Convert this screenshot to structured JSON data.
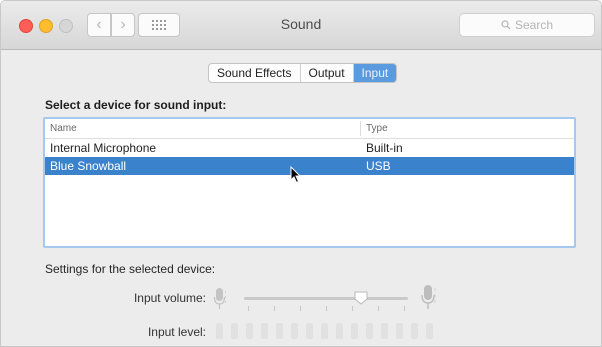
{
  "window": {
    "title": "Sound"
  },
  "search": {
    "placeholder": "Search"
  },
  "tabs": [
    {
      "label": "Sound Effects",
      "selected": false
    },
    {
      "label": "Output",
      "selected": false
    },
    {
      "label": "Input",
      "selected": true
    }
  ],
  "input_panel": {
    "section_label": "Select a device for sound input:",
    "columns": {
      "name": "Name",
      "type": "Type"
    },
    "devices": [
      {
        "name": "Internal Microphone",
        "type": "Built-in",
        "selected": false
      },
      {
        "name": "Blue Snowball",
        "type": "USB",
        "selected": true
      }
    ],
    "settings_label": "Settings for the selected device:",
    "input_volume_label": "Input volume:",
    "input_level_label": "Input level:",
    "input_volume_fraction": 0.85,
    "input_level_segments": 15
  },
  "icons": {
    "close": "close-button",
    "minimize": "minimize-button",
    "zoom": "zoom-button",
    "back": "chevron-left-icon",
    "forward": "chevron-right-icon",
    "grid": "grid-icon",
    "search": "search-icon",
    "mic": "microphone-icon",
    "cursor": "mouse-pointer"
  },
  "colors": {
    "accent": "#3b82cd",
    "tab_selected": "#5a9be0",
    "close": "#ff5f57",
    "minimize": "#ffbd2e"
  }
}
